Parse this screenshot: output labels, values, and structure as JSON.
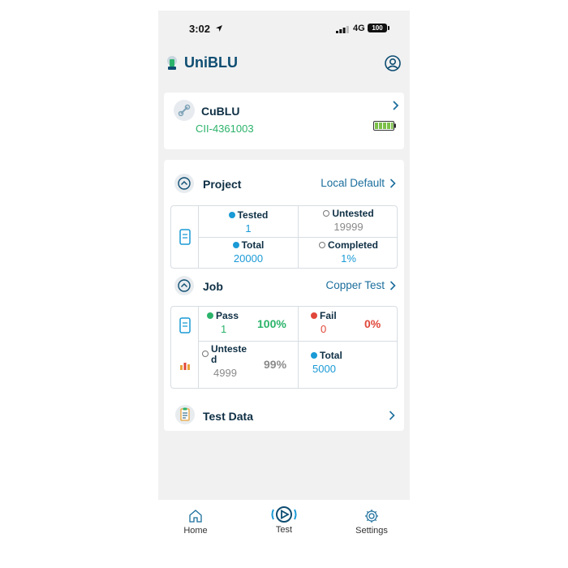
{
  "status_bar": {
    "time": "3:02",
    "network": "4G",
    "battery": "100"
  },
  "header": {
    "title": "UniBLU",
    "logo": "lantern-logo-icon",
    "account_icon": "user-circle-icon"
  },
  "device": {
    "name": "CuBLU",
    "id": "CII-4361003",
    "icon": "cable-tester-icon",
    "battery_icon": "battery-full-icon"
  },
  "project": {
    "title": "Project",
    "link": "Local Default",
    "tested_label": "Tested",
    "tested_value": "1",
    "untested_label": "Untested",
    "untested_value": "19999",
    "total_label": "Total",
    "total_value": "20000",
    "completed_label": "Completed",
    "completed_value": "1%"
  },
  "job": {
    "title": "Job",
    "link": "Copper Test",
    "pass_label": "Pass",
    "pass_value": "1",
    "pass_pct": "100%",
    "fail_label": "Fail",
    "fail_value": "0",
    "fail_pct": "0%",
    "untested_label_1": "Unteste",
    "untested_label_2": "d",
    "untested_value": "4999",
    "untested_pct": "99%",
    "total_label": "Total",
    "total_value": "5000"
  },
  "test_data": {
    "title": "Test Data",
    "icon": "clipboard-icon"
  },
  "tabs": [
    {
      "label": "Home",
      "icon": "home-icon"
    },
    {
      "label": "Test",
      "icon": "play-refresh-icon"
    },
    {
      "label": "Settings",
      "icon": "gear-icon"
    }
  ],
  "colors": {
    "brand": "#0e4d72",
    "link": "#1b6e9c",
    "accent": "#1a9ad6",
    "pass": "#2bb36a",
    "fail": "#e0473a"
  }
}
